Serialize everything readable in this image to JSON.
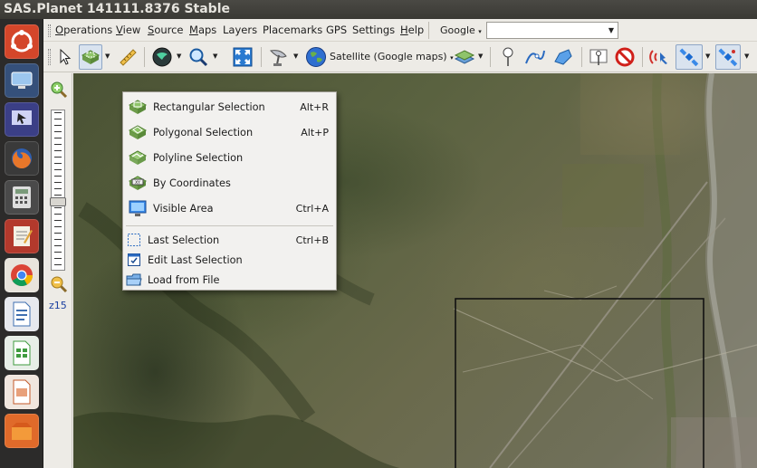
{
  "window": {
    "title": "SAS.Planet 141111.8376 Stable"
  },
  "launcher": {
    "items": [
      {
        "name": "ubuntu-dash",
        "color": "#d4462a"
      },
      {
        "name": "tv-app",
        "color": "#3a5a8a"
      },
      {
        "name": "presentation-app",
        "color": "#3b3f86"
      },
      {
        "name": "firefox",
        "color": "#e4752a"
      },
      {
        "name": "calculator",
        "color": "#5a5a5a"
      },
      {
        "name": "text-editor",
        "color": "#c43b2f"
      },
      {
        "name": "chrome",
        "color": "#2f8a4a"
      },
      {
        "name": "libreoffice-writer",
        "color": "#3f6fb0"
      },
      {
        "name": "libreoffice-calc",
        "color": "#3f9b3f"
      },
      {
        "name": "libreoffice-impress",
        "color": "#c35a2a"
      },
      {
        "name": "sas-planet",
        "color": "#e06a2a"
      }
    ]
  },
  "menubar": {
    "items": [
      {
        "label": "Operations",
        "accel": "O",
        "rest": "perations"
      },
      {
        "label": "View",
        "accel": "V",
        "rest": "iew"
      },
      {
        "label": "Source",
        "accel": "S",
        "rest": "ource"
      },
      {
        "label": "Maps",
        "accel": "M",
        "rest": "aps"
      },
      {
        "label": "Layers",
        "accel": "",
        "rest": "Layers"
      },
      {
        "label": "Placemarks",
        "accel": "",
        "rest": "Placemarks"
      },
      {
        "label": "GPS",
        "accel": "",
        "rest": "GPS"
      },
      {
        "label": "Settings",
        "accel": "",
        "rest": "Settings"
      },
      {
        "label": "Help",
        "accel": "H",
        "rest": "elp"
      }
    ],
    "search_provider": "Google",
    "search_value": ""
  },
  "toolbar": {
    "map_type_label": "Satellite (Google maps)"
  },
  "zoom": {
    "label": "z15",
    "level_fraction": 0.58
  },
  "selection_menu": {
    "items": [
      {
        "label": "Rectangular Selection",
        "shortcut": "Alt+R",
        "icon": "rectangular-selection-icon"
      },
      {
        "label": "Polygonal Selection",
        "shortcut": "Alt+P",
        "icon": "polygonal-selection-icon"
      },
      {
        "label": "Polyline Selection",
        "shortcut": "",
        "icon": "polyline-selection-icon"
      },
      {
        "label": "By Coordinates",
        "shortcut": "",
        "icon": "by-coordinates-icon"
      },
      {
        "label": "Visible Area",
        "shortcut": "Ctrl+A",
        "icon": "visible-area-icon"
      },
      {
        "label": "Last Selection",
        "shortcut": "Ctrl+B",
        "icon": "last-selection-icon"
      },
      {
        "label": "Edit Last Selection",
        "shortcut": "",
        "icon": "edit-last-selection-icon"
      },
      {
        "label": "Load from File",
        "shortcut": "",
        "icon": "load-from-file-icon"
      }
    ]
  },
  "colors": {
    "title_bar": "#3f3e39",
    "launcher_bg": "#2c2b2a",
    "window_bg": "#edebe6",
    "map_green": "#5a6240",
    "selection_rect": "#111111",
    "zoom_label": "#1a3fa0"
  }
}
